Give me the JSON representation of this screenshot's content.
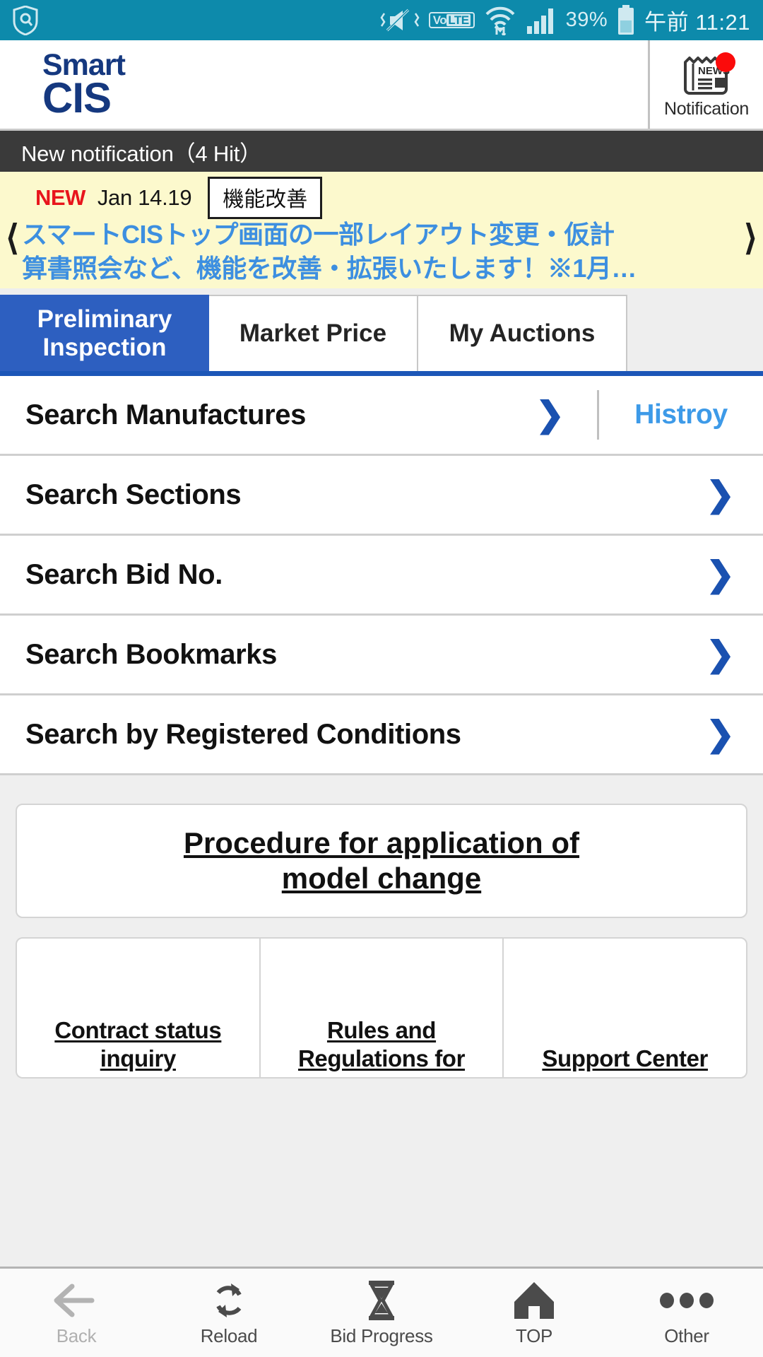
{
  "statusbar": {
    "security_icon": "shield-search-icon",
    "vibrate_icon": "vibrate-mute-icon",
    "volte_label_a": "Vo",
    "volte_label_b": "LTE",
    "wifi_icon": "wifi-data-icon",
    "signal_icon": "signal-bars-icon",
    "battery_percent": "39%",
    "battery_icon": "battery-icon",
    "time": "午前 11:21"
  },
  "header": {
    "logo_line1": "Smart",
    "logo_line2": "CIS",
    "notification_label": "Notification",
    "notification_icon": "news-icon",
    "notification_badge": "new-badge-dot"
  },
  "notification_bar": {
    "text": "New notification（4 Hit）"
  },
  "banner": {
    "new_label": "NEW",
    "date": "Jan 14.19",
    "tag": "機能改善",
    "prev_icon": "chevron-left-icon",
    "next_icon": "chevron-right-icon",
    "headline_line1": "スマートCISトップ画面の一部レイアウト変更・仮計",
    "headline_line2": "算書照会など、機能を改善・拡張いたします！※1月…"
  },
  "tabs": [
    {
      "label": "Preliminary Inspection",
      "active": true
    },
    {
      "label": "Market Price",
      "active": false
    },
    {
      "label": "My Auctions",
      "active": false
    }
  ],
  "search_list": [
    {
      "label": "Search Manufactures",
      "chevron": "chevron-right-icon",
      "history_label": "Histroy"
    },
    {
      "label": "Search Sections",
      "chevron": "chevron-right-icon"
    },
    {
      "label": "Search Bid No.",
      "chevron": "chevron-right-icon"
    },
    {
      "label": "Search Bookmarks",
      "chevron": "chevron-right-icon"
    },
    {
      "label": "Search by Registered Conditions",
      "chevron": "chevron-right-icon"
    }
  ],
  "links": {
    "procedure_line1": "Procedure for application of",
    "procedure_line2": "model change",
    "cards": [
      {
        "line1": "Contract status",
        "line2": "inquiry"
      },
      {
        "line1": "Rules and",
        "line2": "Regulations for"
      },
      {
        "line1": "Support Center",
        "line2": ""
      }
    ]
  },
  "bottom_nav": [
    {
      "label": "Back",
      "icon": "arrow-left-icon",
      "disabled": true
    },
    {
      "label": "Reload",
      "icon": "refresh-icon",
      "disabled": false
    },
    {
      "label": "Bid Progress",
      "icon": "hourglass-icon",
      "disabled": false
    },
    {
      "label": "TOP",
      "icon": "home-icon",
      "disabled": false
    },
    {
      "label": "Other",
      "icon": "more-dots-icon",
      "disabled": false
    }
  ],
  "colors": {
    "statusbar_teal": "#0d8aab",
    "logo_blue": "#15387f",
    "tab_active_blue": "#2d5fc0",
    "chevron_blue": "#1a51b0",
    "history_blue": "#3d9ae8",
    "banner_yellow": "#fcf9cd",
    "banner_text_blue": "#3d8fe0",
    "new_red": "#e8151c",
    "notifbar_dark": "#3a3a3a"
  }
}
